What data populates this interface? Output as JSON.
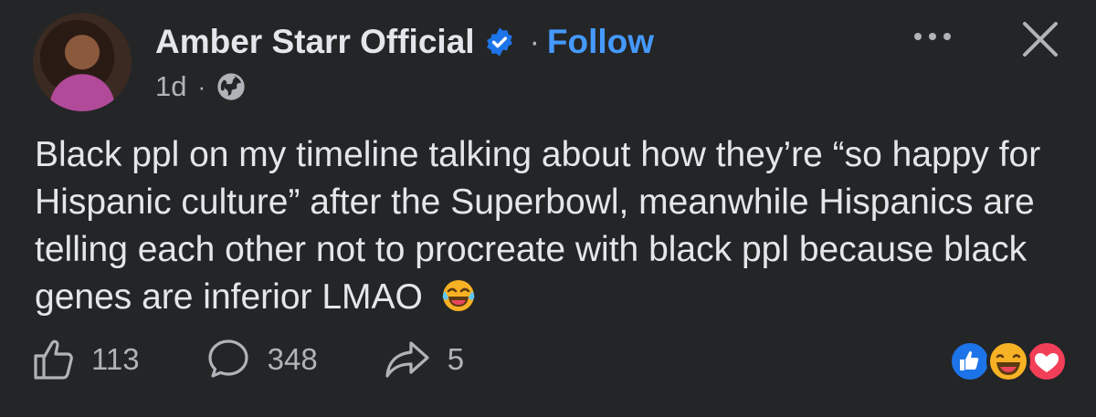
{
  "post": {
    "author": "Amber Starr Official",
    "follow_label": "Follow",
    "separator": "·",
    "timestamp": "1d",
    "audience_icon": "globe-icon",
    "body": "Black ppl on my timeline talking about how they’re “so happy for Hispanic culture” after the Superbowl, meanwhile Hispanics are telling each other not to procreate with black ppl because black genes are inferior LMAO",
    "body_emoji": "laughing-tears-emoji"
  },
  "engagement": {
    "likes": "113",
    "comments": "348",
    "shares": "5"
  },
  "reactions": [
    "like",
    "haha",
    "love"
  ],
  "colors": {
    "background": "#242526",
    "text": "#e4e6eb",
    "secondary": "#b0b3b8",
    "accent": "#4599ff",
    "verified": "#1d74e8",
    "love": "#f33e58",
    "haha": "#f7b125"
  }
}
